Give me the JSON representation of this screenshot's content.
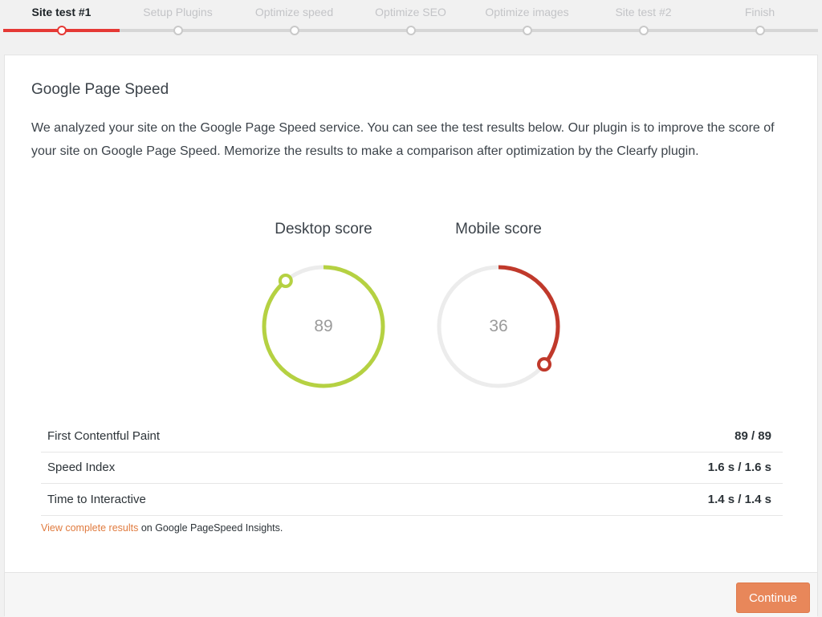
{
  "stepper": {
    "steps": [
      {
        "label": "Site test #1",
        "active": true
      },
      {
        "label": "Setup Plugins",
        "active": false
      },
      {
        "label": "Optimize speed",
        "active": false
      },
      {
        "label": "Optimize SEO",
        "active": false
      },
      {
        "label": "Optimize images",
        "active": false
      },
      {
        "label": "Site test #2",
        "active": false
      },
      {
        "label": "Finish",
        "active": false
      }
    ]
  },
  "card": {
    "title": "Google Page Speed",
    "description": "We analyzed your site on the Google Page Speed service. You can see the test results below. Our plugin is to improve the score of your site on Google Page Speed. Memorize the results to make a comparison after optimization by the Clearfy plugin."
  },
  "scores": {
    "desktop": {
      "label": "Desktop score",
      "value": 89,
      "color": "#b5d142"
    },
    "mobile": {
      "label": "Mobile score",
      "value": 36,
      "color": "#c0392b"
    },
    "track_color": "#ececec"
  },
  "metrics": [
    {
      "name": "First Contentful Paint",
      "value": "89 / 89"
    },
    {
      "name": "Speed Index",
      "value": "1.6 s / 1.6 s"
    },
    {
      "name": "Time to Interactive",
      "value": "1.4 s / 1.4 s"
    }
  ],
  "results_note": {
    "link_text": "View complete results",
    "suffix": " on Google PageSpeed Insights."
  },
  "footer": {
    "continue_label": "Continue"
  },
  "colors": {
    "accent": "#e53935",
    "link": "#e07b3f",
    "button": "#e8875a"
  }
}
